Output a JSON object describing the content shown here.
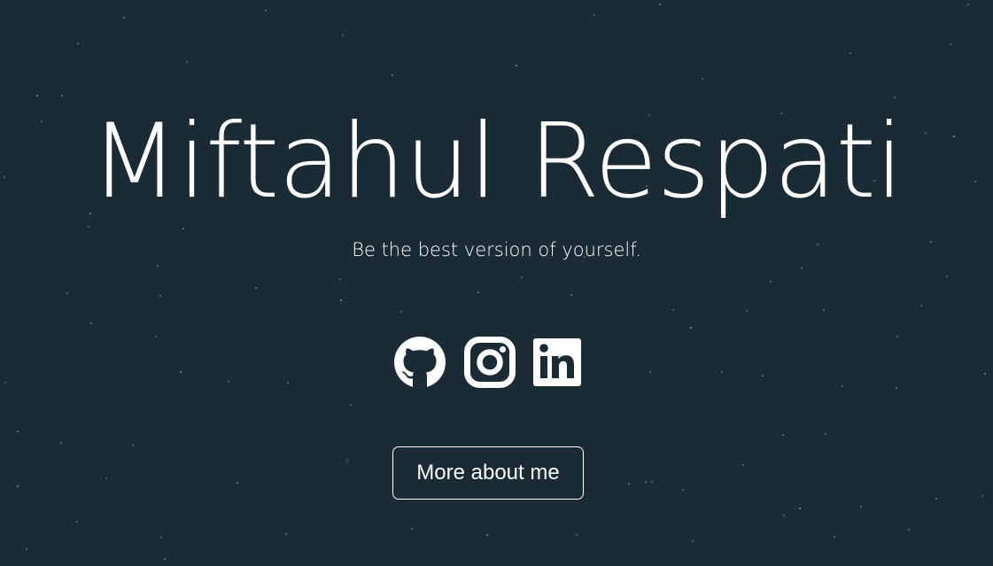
{
  "hero": {
    "name": "Miftahul Respati",
    "tagline": "Be the best version of yourself."
  },
  "socials": [
    {
      "icon": "github-icon"
    },
    {
      "icon": "instagram-icon"
    },
    {
      "icon": "linkedin-icon"
    }
  ],
  "cta": {
    "label": "More about me"
  },
  "colors": {
    "background": "#1a2b35",
    "foreground": "#ffffff",
    "star": "#c9d4da"
  }
}
